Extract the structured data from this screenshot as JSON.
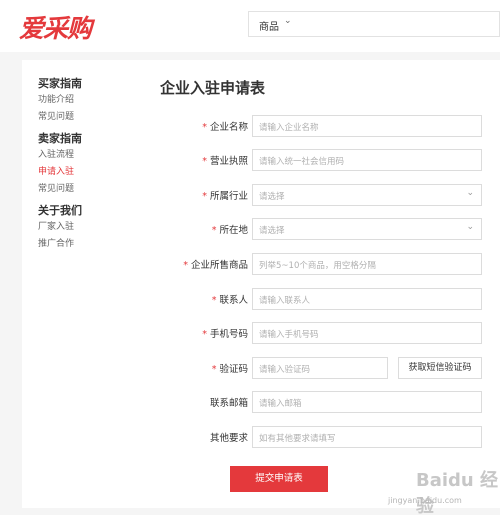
{
  "brand": {
    "logo_text": "爱采购",
    "accent": "#e4393c"
  },
  "header": {
    "search_category": "商品"
  },
  "sidebar": {
    "groups": [
      {
        "title": "买家指南",
        "items": [
          "功能介绍",
          "常见问题"
        ]
      },
      {
        "title": "卖家指南",
        "items": [
          "入驻流程",
          "申请入驻",
          "常见问题"
        ],
        "active_index": 1
      },
      {
        "title": "关于我们",
        "items": [
          "厂家入驻",
          "推广合作"
        ]
      }
    ]
  },
  "form": {
    "title": "企业入驻申请表",
    "fields": [
      {
        "label": "企业名称",
        "required": true,
        "placeholder": "请输入企业名称"
      },
      {
        "label": "营业执照",
        "required": true,
        "placeholder": "请输入统一社会信用码"
      },
      {
        "label": "所属行业",
        "required": true,
        "placeholder": "请选择"
      },
      {
        "label": "所在地",
        "required": true,
        "placeholder": "请选择"
      },
      {
        "label": "企业所售商品",
        "required": true,
        "placeholder": "列举5~10个商品，用空格分隔"
      },
      {
        "label": "联系人",
        "required": true,
        "placeholder": "请输入联系人"
      },
      {
        "label": "手机号码",
        "required": true,
        "placeholder": "请输入手机号码"
      },
      {
        "label": "验证码",
        "required": true,
        "placeholder": "请输入验证码"
      },
      {
        "label": "联系邮箱",
        "required": false,
        "placeholder": "请输入邮箱"
      },
      {
        "label": "其他要求",
        "required": false,
        "placeholder": "如有其他要求请填写"
      }
    ],
    "sms_button": "获取短信验证码",
    "submit_label": "提交申请表",
    "required_mark": "*"
  },
  "watermark": {
    "text": "Baidu 经验",
    "url": "jingyan.baidu.com"
  }
}
